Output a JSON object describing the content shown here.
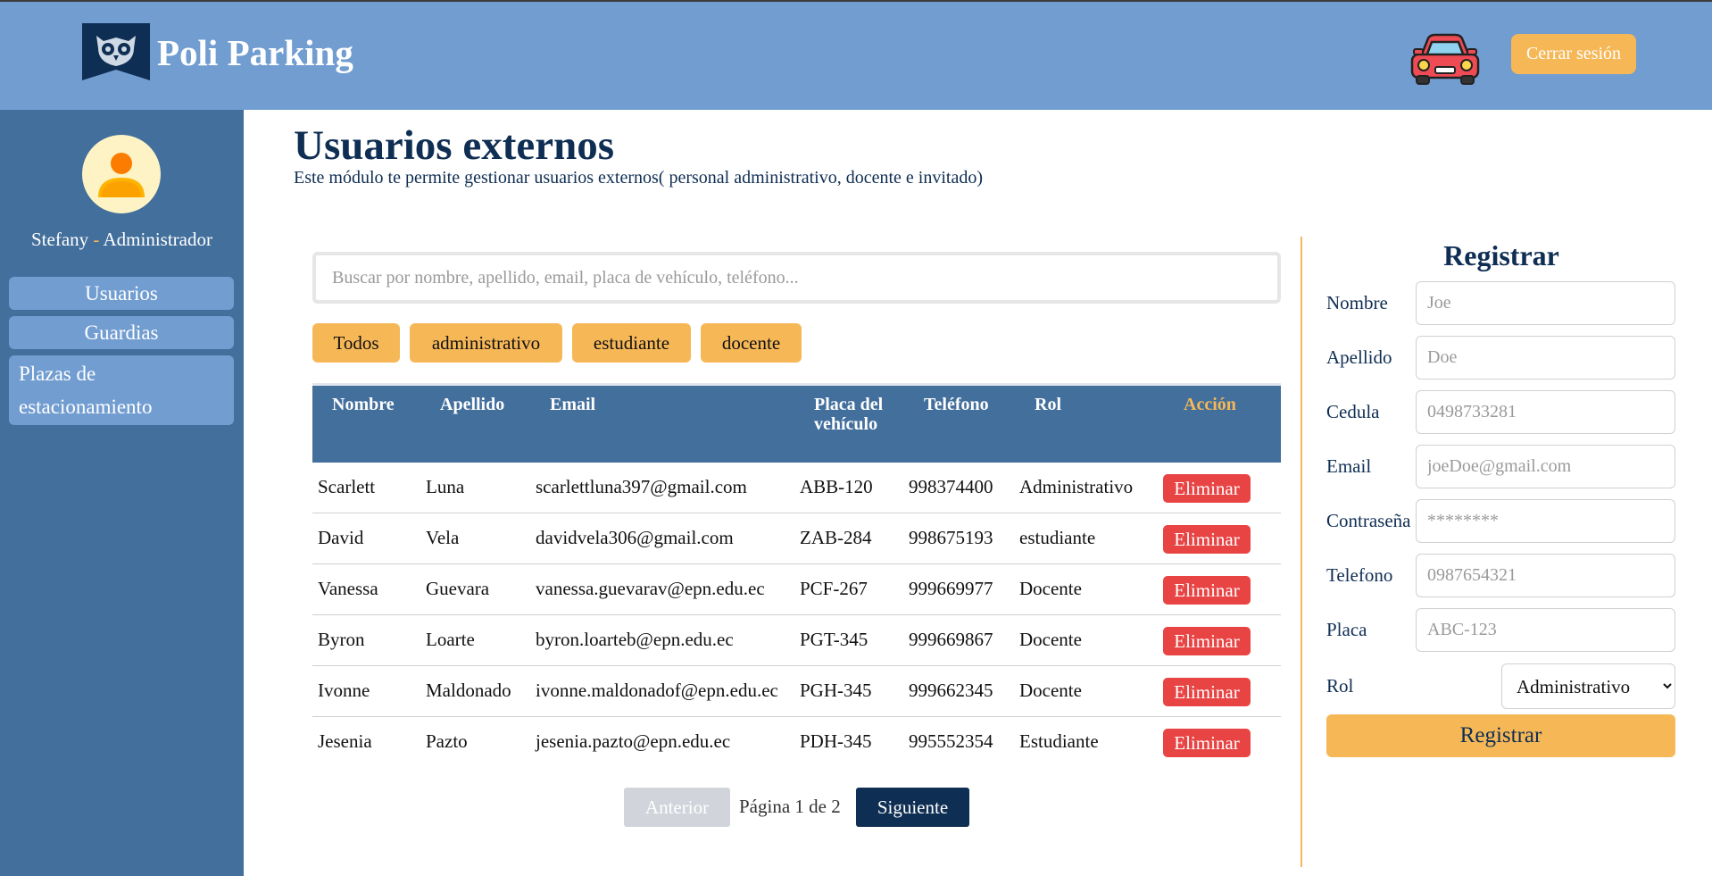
{
  "header": {
    "title": "Poli Parking",
    "logout_label": "Cerrar sesión",
    "logo_icon": "owl-logo-icon",
    "car_icon": "car-icon"
  },
  "sidebar": {
    "user_name": "Stefany",
    "separator": "-",
    "user_role": "Administrador",
    "items": [
      {
        "label": "Usuarios"
      },
      {
        "label": "Guardias"
      },
      {
        "label": "Plazas de estacionamiento"
      }
    ]
  },
  "main": {
    "title": "Usuarios externos",
    "subtitle": "Este módulo te permite gestionar usuarios externos( personal administrativo, docente e invitado)",
    "search_placeholder": "Buscar por nombre, apellido, email, placa de vehículo, teléfono...",
    "filters": [
      {
        "label": "Todos"
      },
      {
        "label": "administrativo"
      },
      {
        "label": "estudiante"
      },
      {
        "label": "docente"
      }
    ],
    "columns": [
      {
        "label": "Nombre"
      },
      {
        "label": "Apellido"
      },
      {
        "label": "Email"
      },
      {
        "label": "Placa del vehículo"
      },
      {
        "label": "Teléfono"
      },
      {
        "label": "Rol"
      },
      {
        "label": "Acción"
      }
    ],
    "delete_label": "Eliminar",
    "rows": [
      {
        "nombre": "Scarlett",
        "apellido": "Luna",
        "email": "scarlettluna397@gmail.com",
        "placa": "ABB-120",
        "telefono": "998374400",
        "rol": "Administrativo"
      },
      {
        "nombre": "David",
        "apellido": "Vela",
        "email": "davidvela306@gmail.com",
        "placa": "ZAB-284",
        "telefono": "998675193",
        "rol": "estudiante"
      },
      {
        "nombre": "Vanessa",
        "apellido": "Guevara",
        "email": "vanessa.guevarav@epn.edu.ec",
        "placa": "PCF-267",
        "telefono": "999669977",
        "rol": "Docente"
      },
      {
        "nombre": "Byron",
        "apellido": "Loarte",
        "email": "byron.loarteb@epn.edu.ec",
        "placa": "PGT-345",
        "telefono": "999669867",
        "rol": "Docente"
      },
      {
        "nombre": "Ivonne",
        "apellido": "Maldonado",
        "email": "ivonne.maldonadof@epn.edu.ec",
        "placa": "PGH-345",
        "telefono": "999662345",
        "rol": "Docente"
      },
      {
        "nombre": "Jesenia",
        "apellido": "Pazto",
        "email": "jesenia.pazto@epn.edu.ec",
        "placa": "PDH-345",
        "telefono": "995552354",
        "rol": "Estudiante"
      }
    ],
    "pagination": {
      "prev_label": "Anterior",
      "info": "Página 1 de 2",
      "next_label": "Siguiente"
    }
  },
  "form": {
    "title": "Registrar",
    "fields": [
      {
        "label": "Nombre",
        "placeholder": "Joe"
      },
      {
        "label": "Apellido",
        "placeholder": "Doe"
      },
      {
        "label": "Cedula",
        "placeholder": "0498733281"
      },
      {
        "label": "Email",
        "placeholder": "joeDoe@gmail.com"
      },
      {
        "label": "Contraseña",
        "placeholder": "********"
      },
      {
        "label": "Telefono",
        "placeholder": "0987654321"
      },
      {
        "label": "Placa",
        "placeholder": "ABC-123"
      }
    ],
    "rol_label": "Rol",
    "rol_selected": "Administrativo",
    "submit_label": "Registrar"
  },
  "colors": {
    "header_bg": "#729dd0",
    "sidebar_bg": "#426f9c",
    "accent": "#f6b757",
    "navy": "#0f2e53",
    "danger": "#e84444"
  }
}
